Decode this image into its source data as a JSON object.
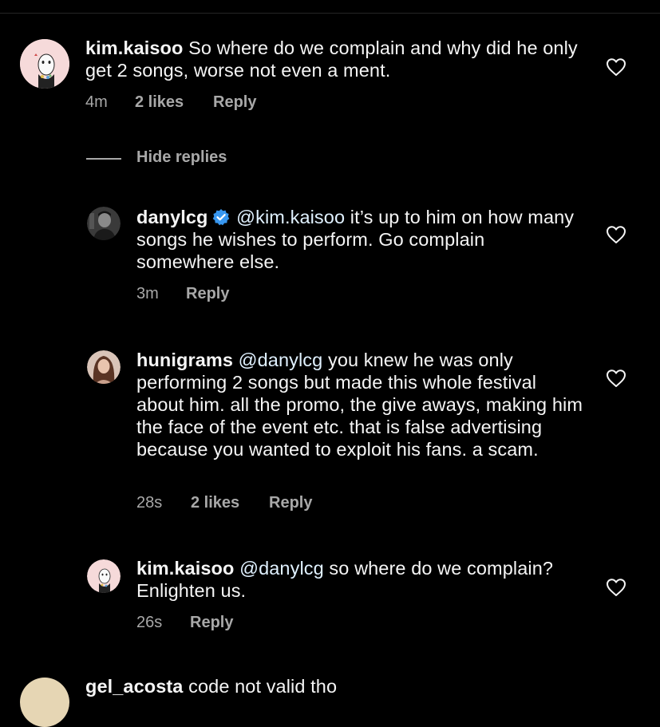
{
  "comments": [
    {
      "username": "kim.kaisoo",
      "text": "So where do we complain and why did he only get 2 songs, worse not even a ment.",
      "time": "4m",
      "likes": "2 likes",
      "reply_label": "Reply"
    }
  ],
  "hide_replies_label": "Hide replies",
  "replies": [
    {
      "username": "danylcg",
      "verified": true,
      "mention": "@kim.kaisoo",
      "text": "it’s up to him on how many songs he wishes to perform. Go complain somewhere else.",
      "time": "3m",
      "reply_label": "Reply"
    },
    {
      "username": "hunigrams",
      "mention": "@danylcg",
      "text": "you knew he was only performing 2 songs but made this whole festival about him. all the promo, the give aways, making him the face of the event etc. that is false advertising because you wanted to exploit his fans. a scam.",
      "time": "28s",
      "likes": "2 likes",
      "reply_label": "Reply"
    },
    {
      "username": "kim.kaisoo",
      "mention": "@danylcg",
      "text": "so where do we complain? Enlighten us.",
      "time": "26s",
      "reply_label": "Reply"
    }
  ],
  "next_comment": {
    "username": "gel_acosta",
    "text": "code not valid tho"
  },
  "colors": {
    "background": "#000000",
    "text": "#f5f5f5",
    "secondary": "#a8a8a8",
    "verified": "#3897f0"
  },
  "icons": {
    "like": "heart-icon",
    "verified": "verified-badge-icon"
  }
}
